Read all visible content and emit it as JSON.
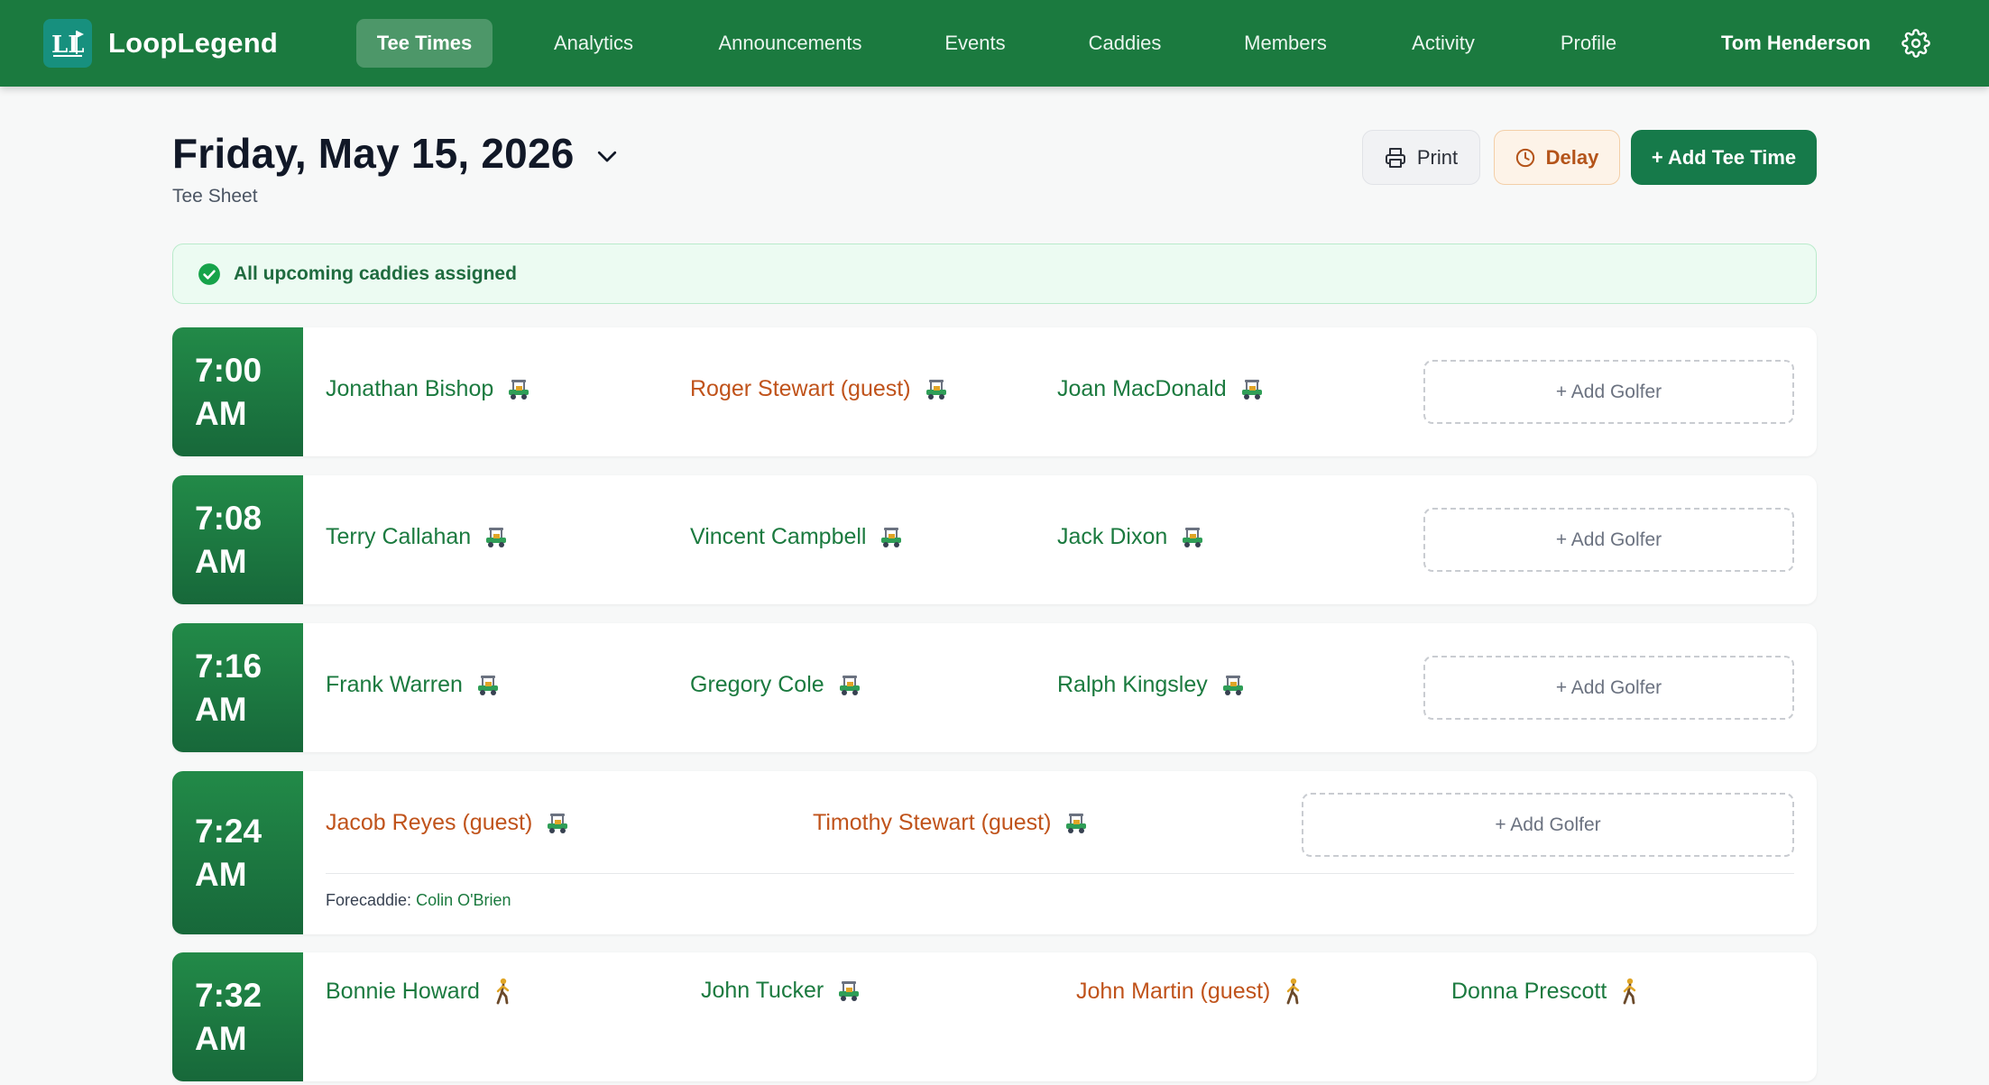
{
  "app": {
    "name": "LoopLegend",
    "logo_letters": "LL"
  },
  "nav": {
    "items": [
      {
        "label": "Tee Times",
        "active": true
      },
      {
        "label": "Analytics",
        "active": false
      },
      {
        "label": "Announcements",
        "active": false
      },
      {
        "label": "Events",
        "active": false
      },
      {
        "label": "Caddies",
        "active": false
      },
      {
        "label": "Members",
        "active": false
      },
      {
        "label": "Activity",
        "active": false
      },
      {
        "label": "Profile",
        "active": false
      }
    ],
    "user_name": "Tom Henderson",
    "settings_icon": "gear-icon"
  },
  "header": {
    "date": "Friday, May 15, 2026",
    "subtitle": "Tee Sheet",
    "print_label": "Print",
    "delay_label": "Delay",
    "add_label": "+ Add Tee Time"
  },
  "banner": {
    "text": "All upcoming caddies assigned"
  },
  "add_golfer_label": "+ Add Golfer",
  "forecaddie_label": "Forecaddie:",
  "colors": {
    "brand_green": "#1b7a3f",
    "guest_orange": "#c0531b",
    "banner_bg": "#ecfbf2"
  },
  "tee_times": [
    {
      "time": "7:00",
      "period": "AM",
      "golfers": [
        {
          "name": "Jonathan Bishop",
          "type": "member",
          "mode": "cart"
        },
        {
          "name": "Roger Stewart (guest)",
          "type": "guest",
          "mode": "cart"
        },
        {
          "name": "Joan MacDonald",
          "type": "member",
          "mode": "cart"
        }
      ]
    },
    {
      "time": "7:08",
      "period": "AM",
      "golfers": [
        {
          "name": "Terry Callahan",
          "type": "member",
          "mode": "cart"
        },
        {
          "name": "Vincent Campbell",
          "type": "member",
          "mode": "cart"
        },
        {
          "name": "Jack Dixon",
          "type": "member",
          "mode": "cart"
        }
      ]
    },
    {
      "time": "7:16",
      "period": "AM",
      "golfers": [
        {
          "name": "Frank Warren",
          "type": "member",
          "mode": "cart"
        },
        {
          "name": "Gregory Cole",
          "type": "member",
          "mode": "cart"
        },
        {
          "name": "Ralph Kingsley",
          "type": "member",
          "mode": "cart"
        }
      ]
    },
    {
      "time": "7:24",
      "period": "AM",
      "golfers": [
        {
          "name": "Jacob Reyes (guest)",
          "type": "guest",
          "mode": "cart"
        },
        {
          "name": "Timothy Stewart (guest)",
          "type": "guest",
          "mode": "cart"
        }
      ],
      "forecaddie": "Colin O'Brien"
    },
    {
      "time": "7:32",
      "period": "AM",
      "golfers": [
        {
          "name": "Bonnie Howard",
          "type": "member",
          "mode": "walking"
        },
        {
          "name": "John Tucker",
          "type": "member",
          "mode": "cart"
        },
        {
          "name": "John Martin (guest)",
          "type": "guest",
          "mode": "walking"
        },
        {
          "name": "Donna Prescott",
          "type": "member",
          "mode": "walking"
        }
      ]
    }
  ]
}
